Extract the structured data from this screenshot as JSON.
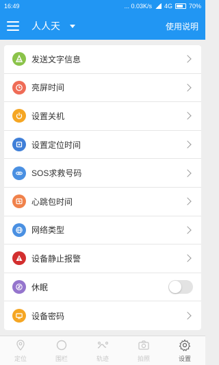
{
  "status_bar": {
    "time": "16:49",
    "network_speed": "... 0.03K/s",
    "network": "4G",
    "battery": "70%"
  },
  "app_bar": {
    "title": "人人天",
    "help": "使用说明"
  },
  "settings": [
    {
      "label": "发送文字信息",
      "icon": "text-message-icon",
      "color": "#8bc34a",
      "control": "chevron"
    },
    {
      "label": "亮屏时间",
      "icon": "clock-icon",
      "color": "#ef6c57",
      "control": "chevron"
    },
    {
      "label": "设置关机",
      "icon": "power-icon",
      "color": "#f5a623",
      "control": "chevron"
    },
    {
      "label": "设置定位时间",
      "icon": "locate-icon",
      "color": "#3f7fd8",
      "control": "chevron"
    },
    {
      "label": "SOS求救号码",
      "icon": "link-icon",
      "color": "#4a90e2",
      "control": "chevron"
    },
    {
      "label": "心跳包时间",
      "icon": "heartbeat-icon",
      "color": "#f0824b",
      "control": "chevron"
    },
    {
      "label": "网络类型",
      "icon": "globe-icon",
      "color": "#4a90e2",
      "control": "chevron"
    },
    {
      "label": "设备静止报警",
      "icon": "warning-icon",
      "color": "#d32f2f",
      "control": "chevron"
    },
    {
      "label": "休眠",
      "icon": "sleep-icon",
      "color": "#9575cd",
      "control": "toggle",
      "enabled": false
    },
    {
      "label": "设备密码",
      "icon": "password-icon",
      "color": "#f5a623",
      "control": "chevron"
    }
  ],
  "tabs": [
    {
      "label": "定位",
      "icon": "location-pin-icon",
      "active": false
    },
    {
      "label": "围栏",
      "icon": "fence-circle-icon",
      "active": false
    },
    {
      "label": "轨迹",
      "icon": "track-icon",
      "active": false
    },
    {
      "label": "拍照",
      "icon": "camera-icon",
      "active": false
    },
    {
      "label": "设置",
      "icon": "settings-gear-icon",
      "active": true
    }
  ]
}
